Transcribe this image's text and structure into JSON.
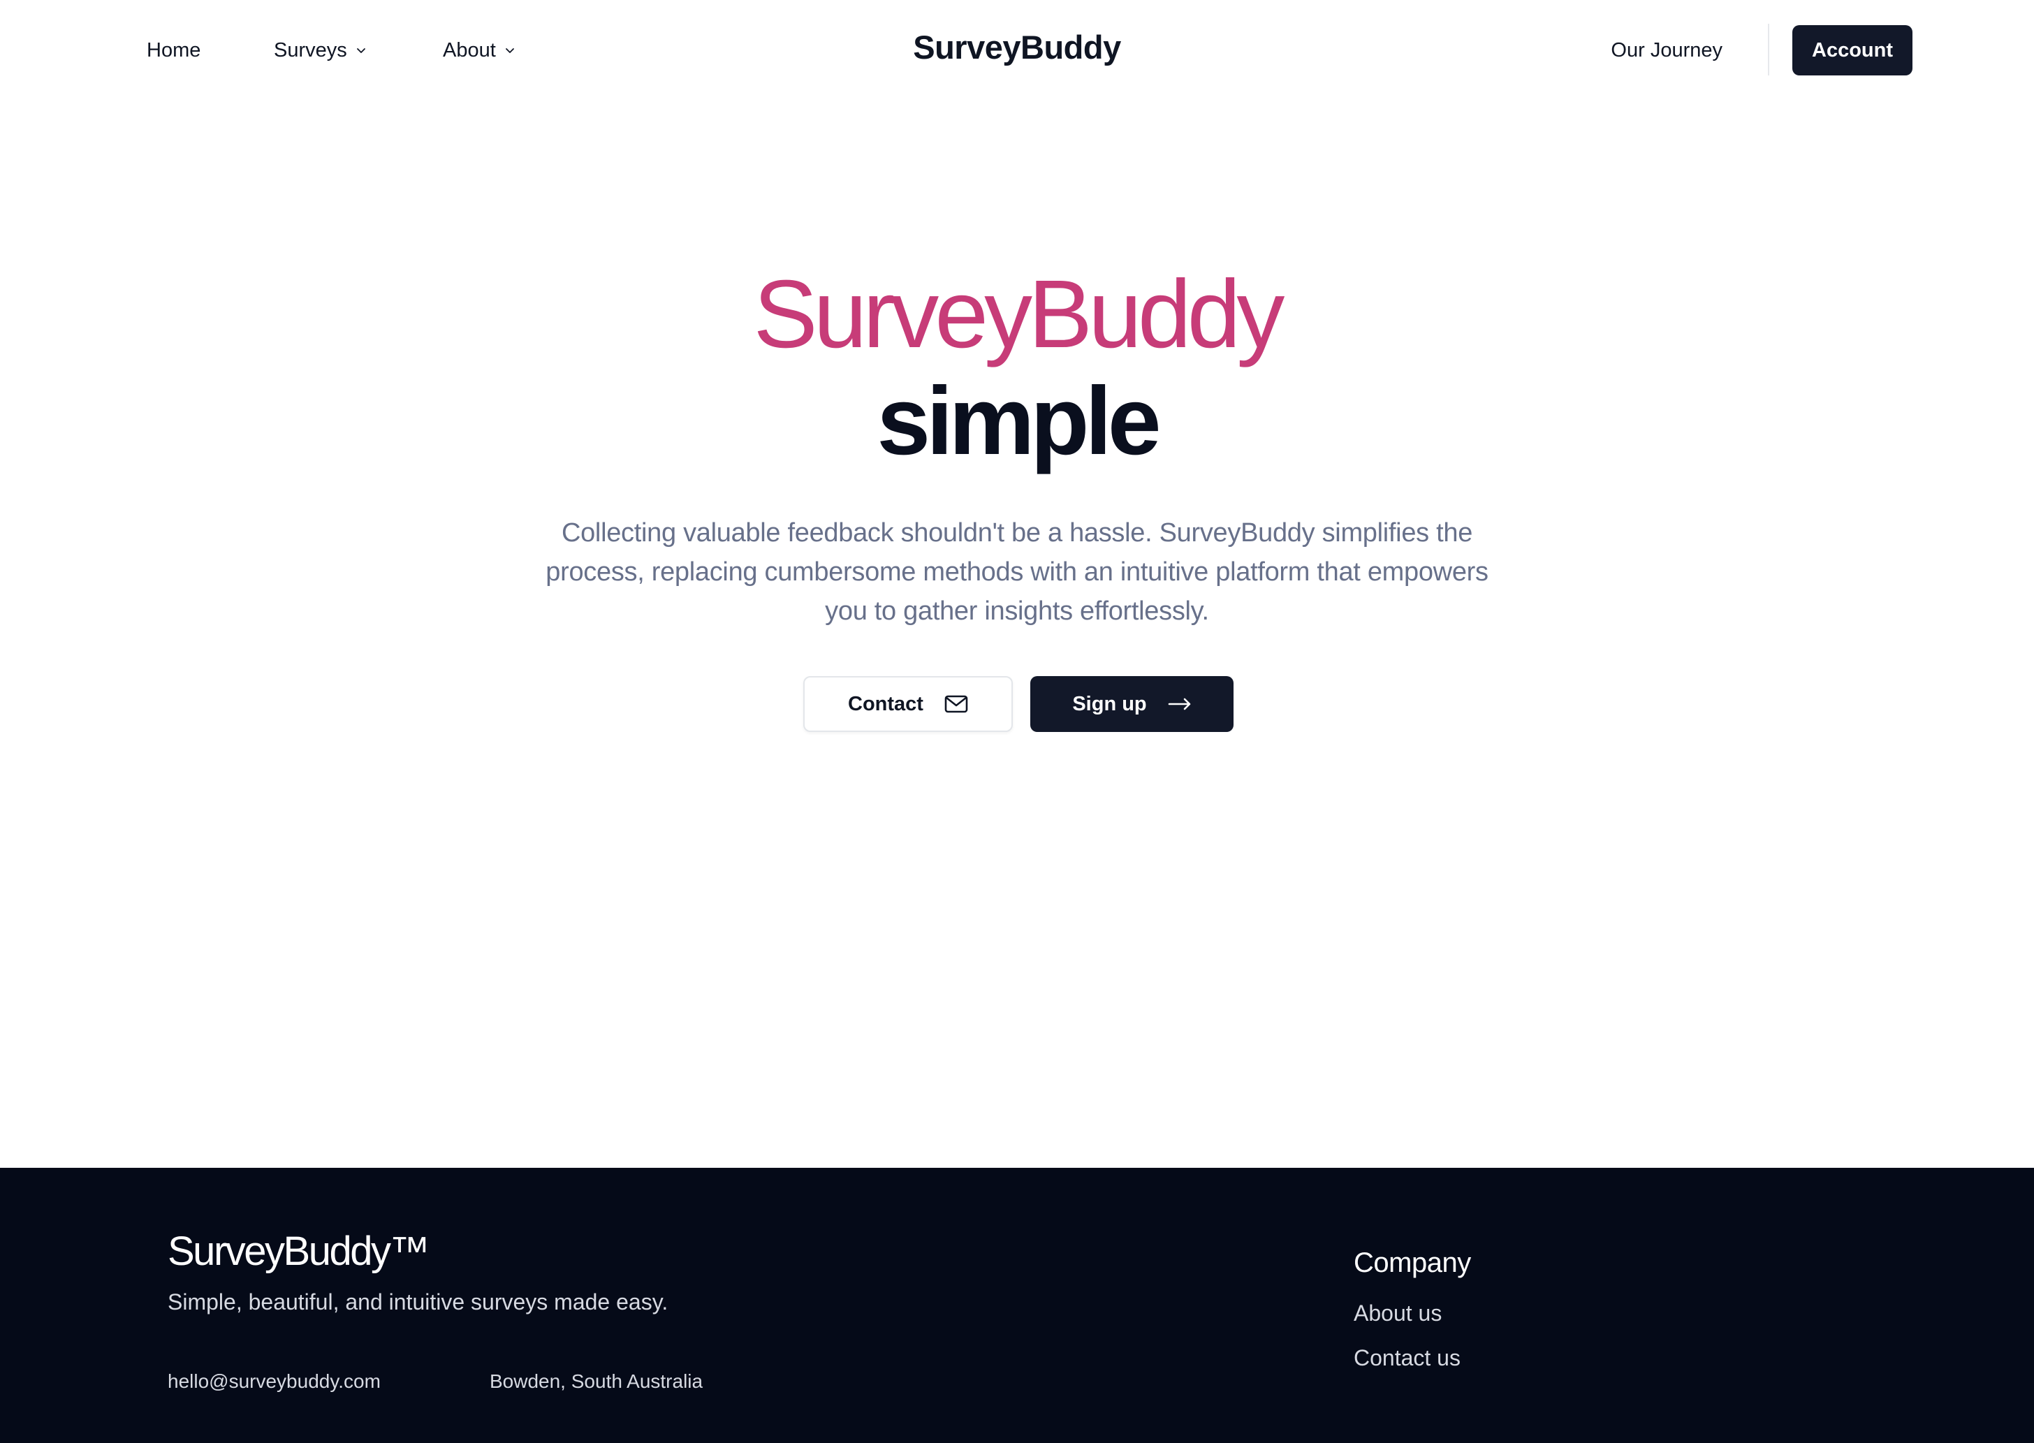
{
  "nav": {
    "home": "Home",
    "surveys": "Surveys",
    "about": "About",
    "brand": "SurveyBuddy",
    "journey": "Our Journey",
    "account": "Account"
  },
  "hero": {
    "title": "SurveyBuddy",
    "subtitle": "simple",
    "description": "Collecting valuable feedback shouldn't be a hassle. SurveyBuddy simplifies the process, replacing cumbersome methods with an intuitive platform that empowers you to gather insights effortlessly.",
    "contact_label": "Contact",
    "signup_label": "Sign up",
    "title_color": "#c73c78",
    "primary_color": "#121829"
  },
  "footer": {
    "brand": "SurveyBuddy™",
    "tagline": "Simple, beautiful, and intuitive surveys made easy.",
    "email": "hello@surveybuddy.com",
    "location": "Bowden, South Australia",
    "company_heading": "Company",
    "links": [
      {
        "label": "About us"
      },
      {
        "label": "Contact us"
      }
    ],
    "background_color": "#050a18"
  },
  "icons": {
    "surveys_chevron": "chevron-down-icon",
    "about_chevron": "chevron-down-icon",
    "contact_icon": "mail-icon",
    "signup_icon": "arrow-right-icon"
  }
}
